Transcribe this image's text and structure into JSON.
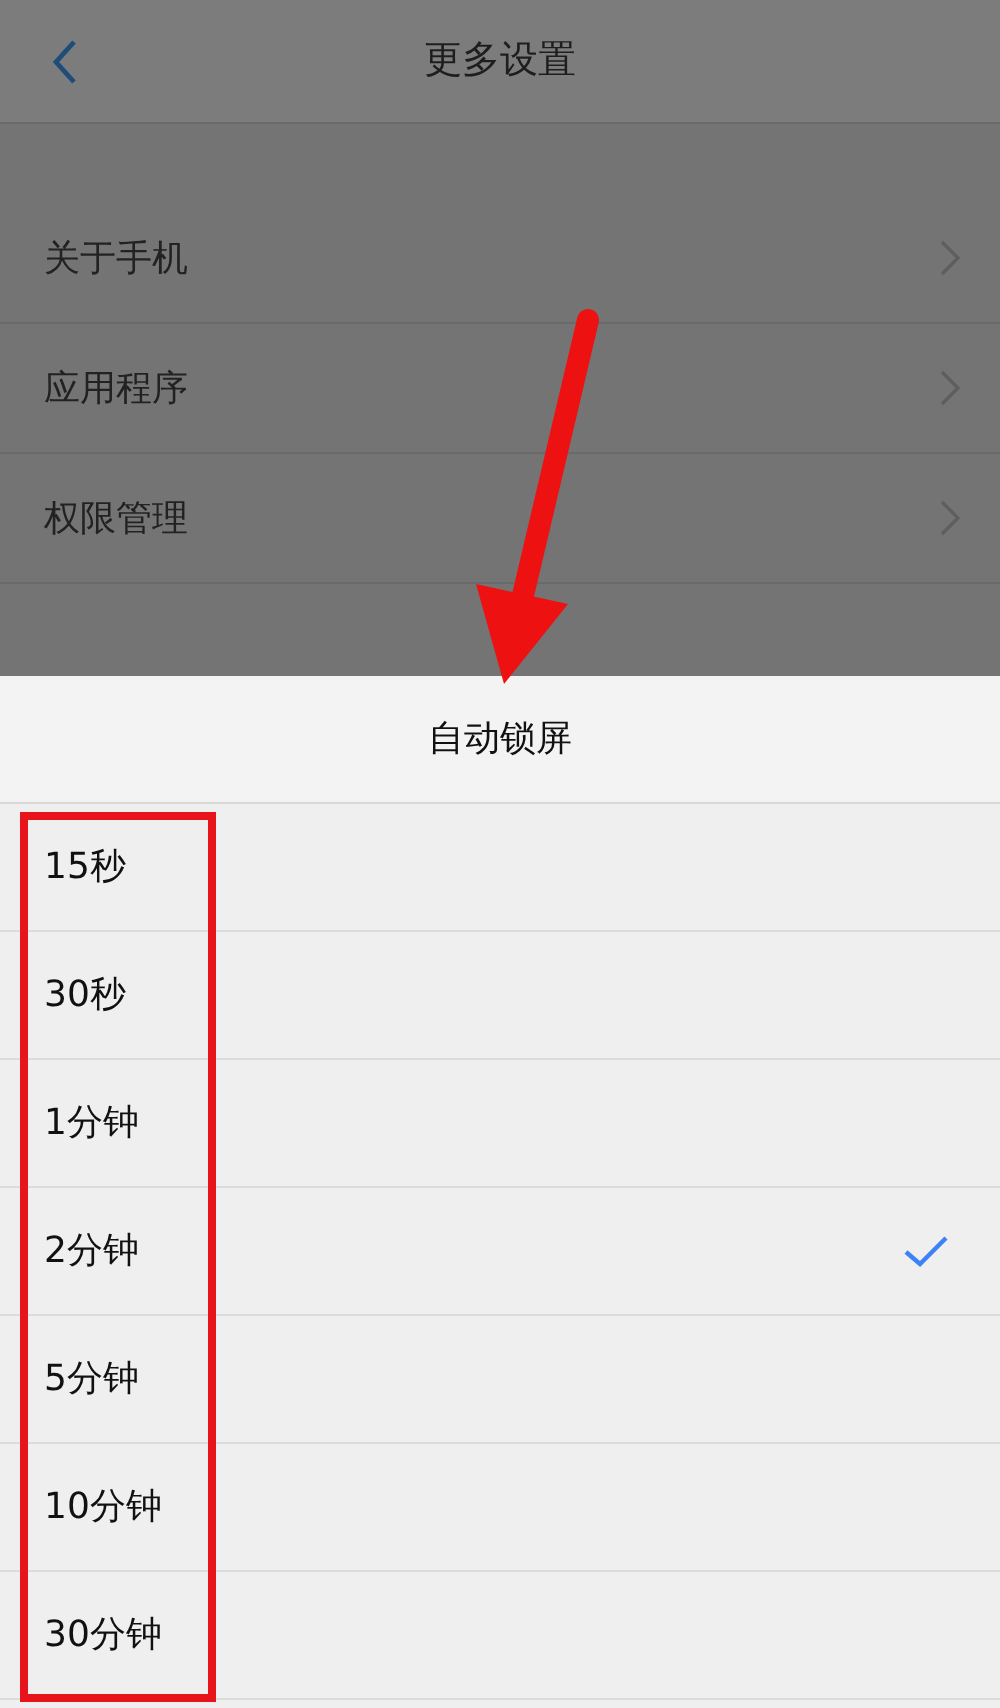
{
  "nav_bar": {
    "title": "更多设置"
  },
  "settings_list": [
    {
      "label": "关于手机"
    },
    {
      "label": "应用程序"
    },
    {
      "label": "权限管理"
    }
  ],
  "action_sheet": {
    "title": "自动锁屏",
    "options": [
      {
        "label": "15秒",
        "selected": false
      },
      {
        "label": "30秒",
        "selected": false
      },
      {
        "label": "1分钟",
        "selected": false
      },
      {
        "label": "2分钟",
        "selected": true
      },
      {
        "label": "5分钟",
        "selected": false
      },
      {
        "label": "10分钟",
        "selected": false
      },
      {
        "label": "30分钟",
        "selected": false
      }
    ]
  }
}
